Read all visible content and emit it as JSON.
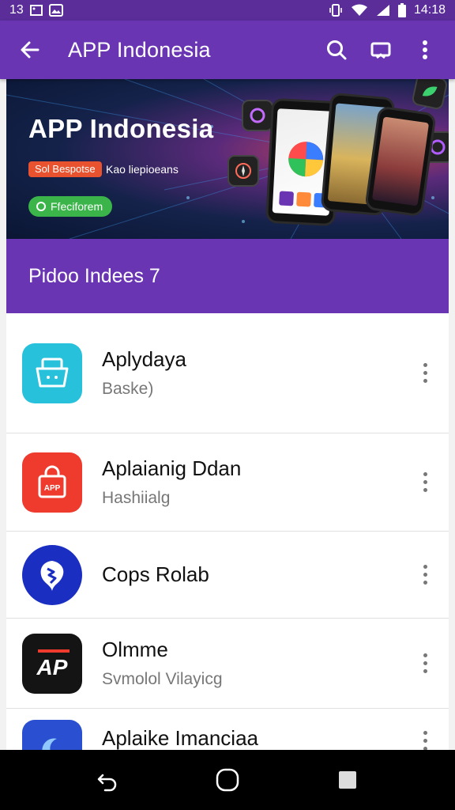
{
  "status_bar": {
    "left_text": "13",
    "time": "14:18",
    "icons": [
      "image-icon",
      "photos-icon",
      "vibrate-icon",
      "wifi-icon",
      "signal-icon",
      "battery-icon"
    ]
  },
  "app_bar": {
    "title": "APP Indonesia",
    "icons": [
      "back-arrow-icon",
      "search-icon",
      "cast-icon",
      "more-vert-icon"
    ],
    "color": "#6a35b3"
  },
  "banner": {
    "title": "APP Indonesia",
    "tag": "Sol Bespotse",
    "subtitle": "Kao liepioeans",
    "cta": "Ffeciforem"
  },
  "section": {
    "title": "Pidoo Indees 7"
  },
  "apps": [
    {
      "title": "Aplydaya",
      "subtitle": "Baske)",
      "icon": "basket-icon",
      "icon_bg": "#27c1dc"
    },
    {
      "title": "Aplaianig Ddan",
      "subtitle": "Hashiialg",
      "icon": "shopping-bag-icon",
      "icon_text": "APP",
      "icon_bg": "#ef3b2d"
    },
    {
      "title": "Cops Rolab",
      "subtitle": "",
      "icon": "leaf-icon",
      "icon_bg": "#1a2fc2"
    },
    {
      "title": "Olmme",
      "subtitle": "Svmolol Vilayicg",
      "icon": "ap-logo-icon",
      "icon_text": "AP",
      "icon_bg": "#141414"
    },
    {
      "title": "Aplaike Imanciaa",
      "subtitle": "",
      "icon": "moon-icon",
      "icon_bg": "#2a4fd0"
    }
  ],
  "nav_bar": {
    "icons": [
      "back-icon",
      "home-icon",
      "recents-icon"
    ]
  }
}
